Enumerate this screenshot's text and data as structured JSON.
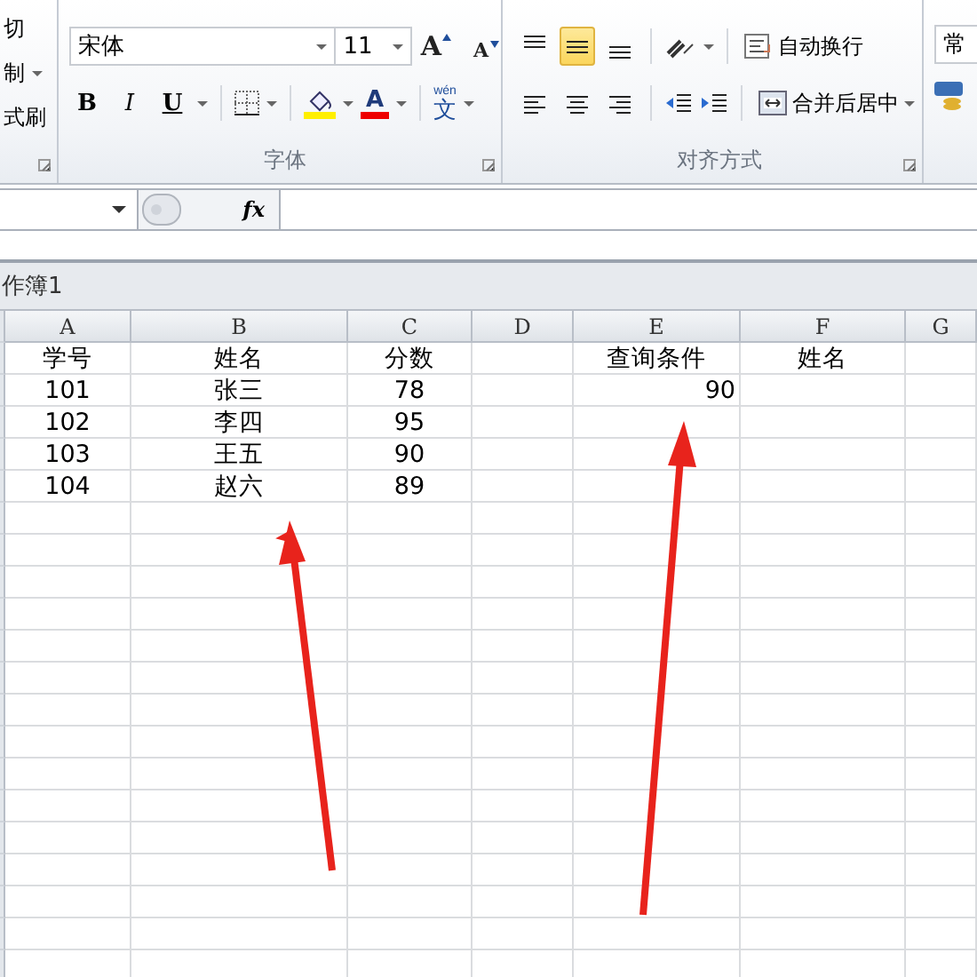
{
  "clipboard": {
    "items": [
      {
        "label": "切",
        "dropdown": false
      },
      {
        "label": "制",
        "dropdown": true
      },
      {
        "label": "式刷",
        "dropdown": false
      }
    ]
  },
  "font_group": {
    "font_name": "宋体",
    "font_size": "11",
    "grow_glyph": "A",
    "shrink_glyph": "A",
    "color_glyph": "A",
    "bold": "B",
    "italic": "I",
    "underline": "U",
    "phonetic_ruby": "wén",
    "phonetic_char": "文",
    "label": "字体"
  },
  "alignment": {
    "vertical": [
      {
        "kind": "top",
        "selected": false
      },
      {
        "kind": "middle",
        "selected": true
      },
      {
        "kind": "bottom",
        "selected": false
      }
    ],
    "wrap_text": "自动换行",
    "merge_center": "合并后居中",
    "label": "对齐方式"
  },
  "number": {
    "format": "常"
  },
  "formula_bar": {
    "fx": "fx"
  },
  "workbook": {
    "title": "作簿1"
  },
  "sheet": {
    "columns": [
      "A",
      "B",
      "C",
      "D",
      "E",
      "F",
      "G"
    ],
    "rows": [
      {
        "A": {
          "text": "学号"
        },
        "B": {
          "text": "姓名"
        },
        "C": {
          "text": "分数"
        },
        "E": {
          "text": "查询条件"
        },
        "F": {
          "text": "姓名"
        }
      },
      {
        "A": {
          "text": "101"
        },
        "B": {
          "text": "张三"
        },
        "C": {
          "text": "78"
        },
        "E": {
          "text": "90",
          "right_aligned": true
        }
      },
      {
        "A": {
          "text": "102"
        },
        "B": {
          "text": "李四"
        },
        "C": {
          "text": "95"
        }
      },
      {
        "A": {
          "text": "103"
        },
        "B": {
          "text": "王五"
        },
        "C": {
          "text": "90"
        }
      },
      {
        "A": {
          "text": "104"
        },
        "B": {
          "text": "赵六"
        },
        "C": {
          "text": "89"
        }
      }
    ]
  }
}
